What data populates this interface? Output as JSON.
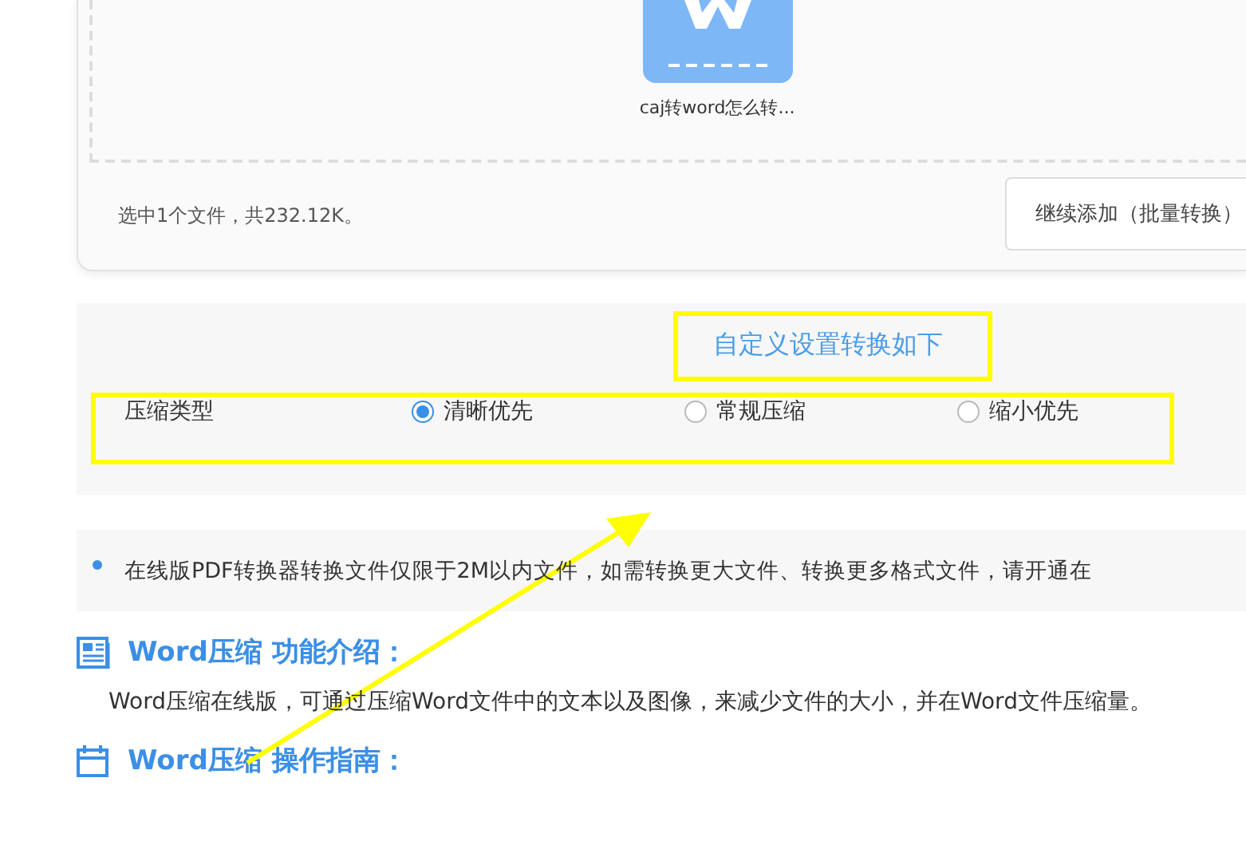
{
  "upload": {
    "file_name": "caj转word怎么转...",
    "summary": "选中1个文件，共232.12K。",
    "add_button": "继续添加（批量转换）"
  },
  "settings": {
    "title": "自定义设置转换如下",
    "compression_type": {
      "label": "压缩类型",
      "options": [
        {
          "label": "清晰优先",
          "selected": true
        },
        {
          "label": "常规压缩",
          "selected": false
        },
        {
          "label": "缩小优先",
          "selected": false
        }
      ]
    }
  },
  "notice": "在线版PDF转换器转换文件仅限于2M以内文件，如需转换更大文件、转换更多格式文件，请开通在",
  "sections": [
    {
      "kind": "intro",
      "title": "Word压缩 功能介绍：",
      "paragraph": "Word压缩在线版，可通过压缩Word文件中的文本以及图像，来减少文件的大小，并在Word文件压缩量。"
    },
    {
      "kind": "guide",
      "title": "Word压缩 操作指南："
    }
  ]
}
